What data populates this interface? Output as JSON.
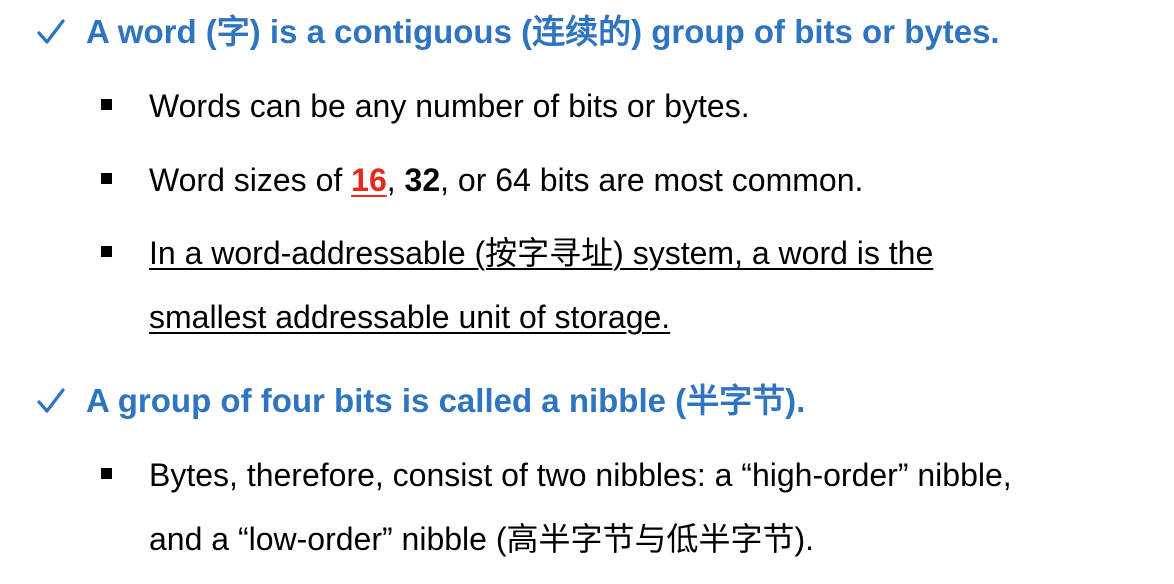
{
  "bullets": {
    "b1": {
      "check_icon": "checkmark-icon",
      "text": "A word (字) is a contiguous (连续的) group of bits or bytes."
    },
    "b1_1": {
      "icon": "square-bullet-icon",
      "text": "Words can be any number of bits or bytes."
    },
    "b1_2": {
      "icon": "square-bullet-icon",
      "prefix": "Word sizes of ",
      "num1": "16",
      "sep1": ", ",
      "num2": "32",
      "suffix": ", or 64 bits are most common."
    },
    "b1_3": {
      "icon": "square-bullet-icon",
      "line1": "In a word-addressable (按字寻址) system, a word is the",
      "line2": "smallest addressable unit of storage."
    },
    "b2": {
      "check_icon": "checkmark-icon",
      "text": "A group of four bits is called a nibble (半字节)."
    },
    "b2_1": {
      "icon": "square-bullet-icon",
      "line1": "Bytes, therefore, consist of two nibbles: a “high-order” nibble,",
      "line2": "and a “low-order” nibble (高半字节与低半字节)."
    }
  },
  "colors": {
    "heading": "#2f74c0",
    "highlight": "#e8271d",
    "body": "#000000"
  }
}
